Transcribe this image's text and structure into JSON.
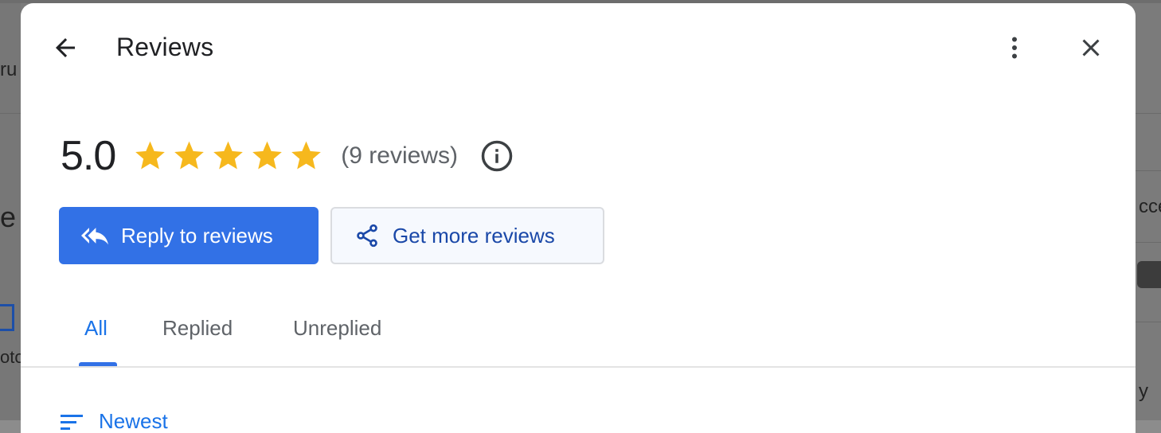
{
  "background": {
    "left_snippets": [
      "ru",
      "e",
      "oto"
    ],
    "right_snippets": [
      "cce",
      "y"
    ]
  },
  "dialog": {
    "title": "Reviews",
    "icons": {
      "back": "arrow-left-icon",
      "more": "more-vert-icon",
      "close": "close-icon",
      "info": "info-icon",
      "reply": "reply-all-icon",
      "share": "share-icon",
      "sort": "sort-icon",
      "star": "star-icon"
    },
    "rating": {
      "value": "5.0",
      "stars": 5,
      "count_text": "(9 reviews)"
    },
    "buttons": {
      "reply": "Reply to reviews",
      "get_more": "Get more reviews"
    },
    "tabs": [
      {
        "label": "All",
        "selected": true
      },
      {
        "label": "Replied",
        "selected": false
      },
      {
        "label": "Unreplied",
        "selected": false
      }
    ],
    "sort": {
      "label": "Newest"
    }
  },
  "colors": {
    "accent": "#1a73e8",
    "primary_button": "#3271e6",
    "star": "#f4b400",
    "secondary_text": "#5f6368"
  }
}
